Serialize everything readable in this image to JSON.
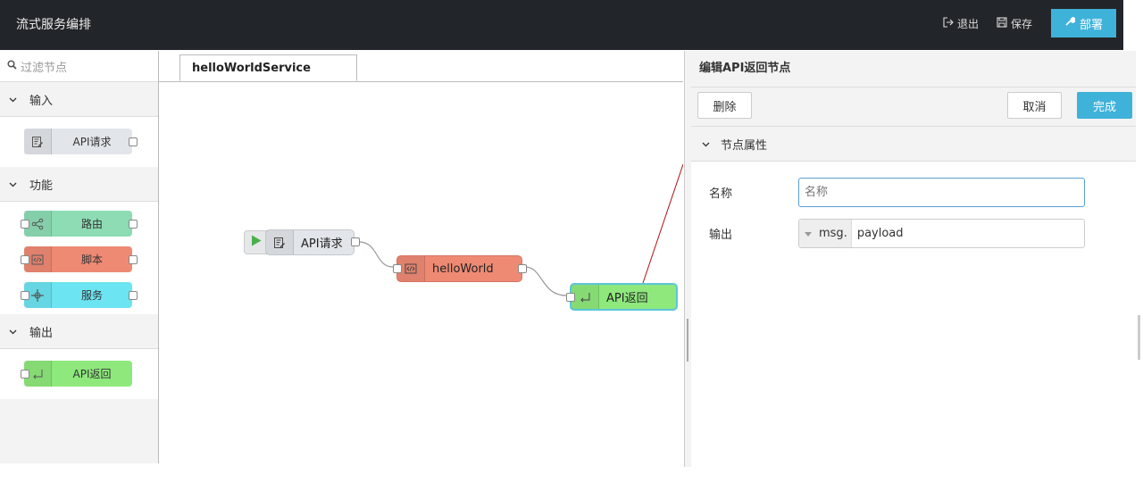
{
  "header": {
    "title": "流式服务编排",
    "logout_label": "退出",
    "save_label": "保存",
    "deploy_label": "部署"
  },
  "palette": {
    "filter_placeholder": "过滤节点",
    "categories": [
      {
        "label": "输入",
        "nodes": [
          {
            "label": "API请求",
            "color": "#e2e6ea",
            "icon": "edit-icon"
          }
        ]
      },
      {
        "label": "功能",
        "nodes": [
          {
            "label": "路由",
            "color": "#8ddcb4",
            "icon": "share-icon"
          },
          {
            "label": "脚本",
            "color": "#ee8a74",
            "icon": "code-icon"
          },
          {
            "label": "服务",
            "color": "#6ce4f1",
            "icon": "plus-icon"
          }
        ]
      },
      {
        "label": "输出",
        "nodes": [
          {
            "label": "API返回",
            "color": "#8ee87c",
            "icon": "return-icon"
          }
        ]
      }
    ]
  },
  "workspace": {
    "tab_label": "helloWorldService",
    "nodes": [
      {
        "label": "API请求",
        "color": "#e2e6ea"
      },
      {
        "label": "helloWorld",
        "color": "#ee8a74"
      },
      {
        "label": "API返回",
        "color": "#8ee87c"
      }
    ]
  },
  "tray": {
    "title": "编辑API返回节点",
    "delete_label": "删除",
    "cancel_label": "取消",
    "done_label": "完成",
    "section_label": "节点属性",
    "name_label": "名称",
    "name_placeholder": "名称",
    "output_label": "输出",
    "output_prefix": "msg.",
    "output_value": "payload"
  },
  "colors": {
    "accent": "#3fb2d9",
    "header_bg": "#222529"
  }
}
